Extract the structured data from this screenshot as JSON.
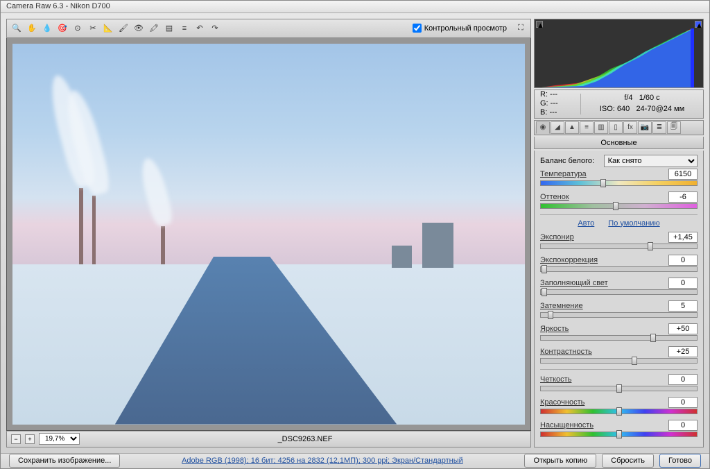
{
  "window_title": "Camera Raw 6.3  -  Nikon D700",
  "preview_checkbox": "Контрольный просмотр",
  "zoom_level": "19,7%",
  "filename": "_DSC9263.NEF",
  "info": {
    "r": "R:  ---",
    "g": "G:  ---",
    "b": "B:  ---",
    "aperture": "f/4",
    "shutter": "1/60 с",
    "iso_label": "ISO: 640",
    "lens": "24-70@24 мм"
  },
  "panel_title": "Основные",
  "wb": {
    "label": "Баланс белого:",
    "value": "Как снято"
  },
  "sliders": {
    "temperature": {
      "label": "Температура",
      "value": "6150",
      "pos": 40
    },
    "tint": {
      "label": "Оттенок",
      "value": "-6",
      "pos": 48
    },
    "exposure": {
      "label": "Экспонир",
      "value": "+1,45",
      "pos": 70
    },
    "recovery": {
      "label": "Экспокоррекция",
      "value": "0",
      "pos": 2
    },
    "fill_light": {
      "label": "Заполняющий свет",
      "value": "0",
      "pos": 2
    },
    "blacks": {
      "label": "Затемнение",
      "value": "5",
      "pos": 6
    },
    "brightness": {
      "label": "Яркость",
      "value": "+50",
      "pos": 72
    },
    "contrast": {
      "label": "Контрастность",
      "value": "+25",
      "pos": 60
    },
    "clarity": {
      "label": "Четкость",
      "value": "0",
      "pos": 50
    },
    "vibrance": {
      "label": "Красочность",
      "value": "0",
      "pos": 50
    },
    "saturation": {
      "label": "Насыщенность",
      "value": "0",
      "pos": 50
    }
  },
  "auto_link": "Авто",
  "default_link": "По умолчанию",
  "footer": {
    "save_image": "Сохранить изображение...",
    "workflow": "Adobe RGB (1998); 16 бит; 4256 на 2832 (12,1МП); 300 ppi; Экран/Стандартный",
    "open_copy": "Открыть копию",
    "reset": "Сбросить",
    "done": "Готово"
  }
}
